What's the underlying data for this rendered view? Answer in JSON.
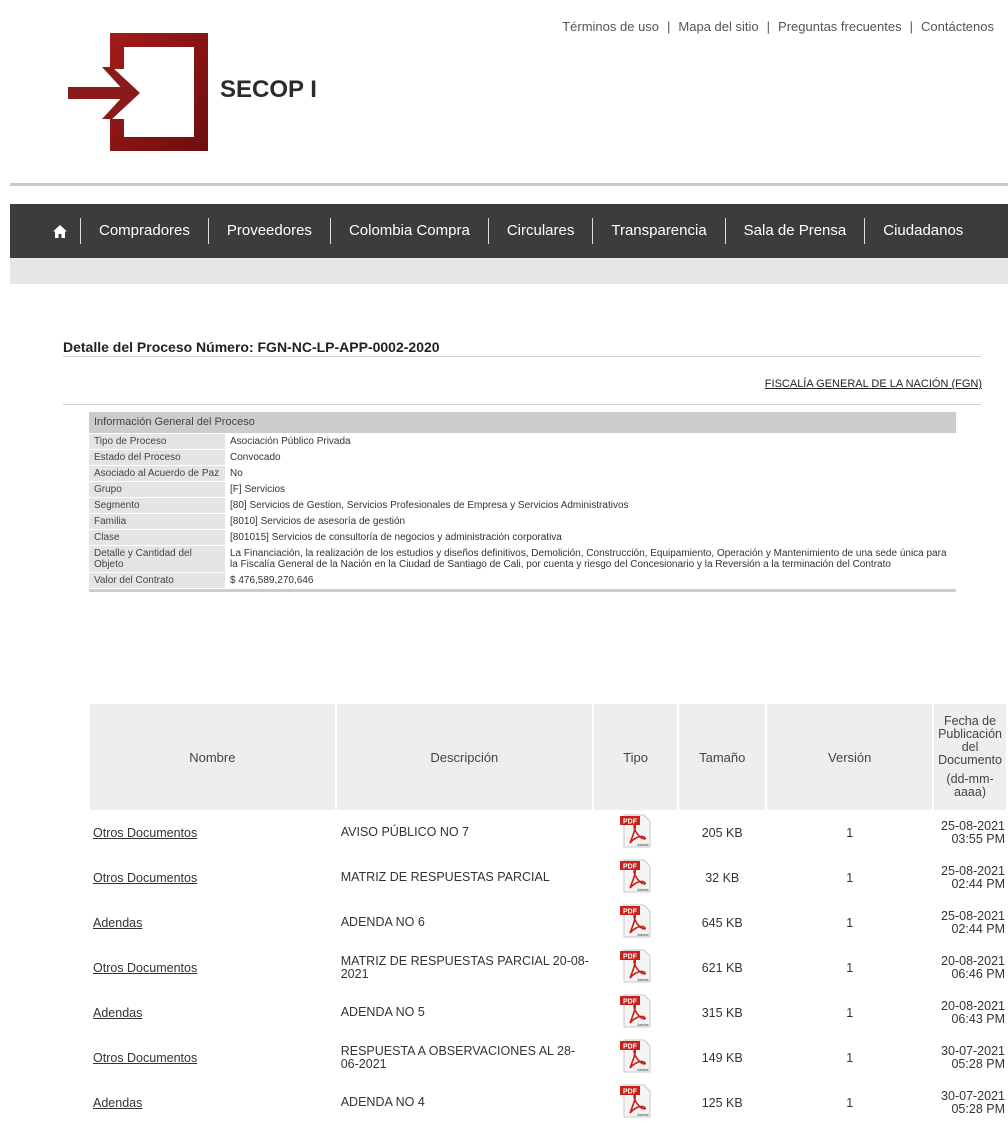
{
  "header": {
    "links": [
      "Términos de uso",
      "Mapa del sitio",
      "Preguntas frecuentes",
      "Contáctenos"
    ],
    "brand": "SECOP I",
    "logo_color": "#8b1a1a"
  },
  "nav": {
    "items": [
      "Compradores",
      "Proveedores",
      "Colombia Compra",
      "Circulares",
      "Transparencia",
      "Sala de Prensa",
      "Ciudadanos"
    ]
  },
  "process": {
    "title": "Detalle del Proceso Número: FGN-NC-LP-APP-0002-2020",
    "entity": "FISCALÍA GENERAL DE LA NACIÓN (FGN)"
  },
  "info": {
    "header": "Información General del Proceso",
    "rows": [
      {
        "label": "Tipo de Proceso",
        "value": "Asociación Público Privada"
      },
      {
        "label": "Estado del Proceso",
        "value": "Convocado"
      },
      {
        "label": "Asociado al Acuerdo de Paz",
        "value": "No"
      },
      {
        "label": "Grupo",
        "value": "[F] Servicios"
      },
      {
        "label": "Segmento",
        "value": "[80] Servicios de Gestion, Servicios Profesionales de Empresa y Servicios Administrativos"
      },
      {
        "label": "Familia",
        "value": "[8010] Servicios de asesoría de gestión"
      },
      {
        "label": "Clase",
        "value": "[801015] Servicios de consultoría de negocios y administración corporativa"
      },
      {
        "label": "Detalle y Cantidad del Objeto",
        "value": "La Financiación, la realización de los estudios y diseños definitivos, Demolición, Construcción, Equipamiento, Operación y Mantenimiento de una sede única para la Fiscalía General de la Nación en la Ciudad de Santiago de Cali, por cuenta y riesgo del Concesionario y la Reversión a la terminación del Contrato"
      },
      {
        "label": "Valor del Contrato",
        "value": "$ 476,589,270,646"
      }
    ]
  },
  "docs": {
    "headers": {
      "nombre": "Nombre",
      "descripcion": "Descripción",
      "tipo": "Tipo",
      "tamano": "Tamaño",
      "version": "Versión",
      "fecha": "Fecha de Publicación del Documento",
      "fecha_fmt": "(dd-mm-aaaa)"
    },
    "rows": [
      {
        "nombre": "Otros Documentos",
        "descripcion": "AVISO PÚBLICO NO 7",
        "tipo": "pdf-icon",
        "tamano": "205 KB",
        "version": "1",
        "fecha": "25-08-2021",
        "hora": "03:55 PM"
      },
      {
        "nombre": "Otros Documentos",
        "descripcion": "MATRIZ DE RESPUESTAS PARCIAL",
        "tipo": "pdf-icon",
        "tamano": "32 KB",
        "version": "1",
        "fecha": "25-08-2021",
        "hora": "02:44 PM"
      },
      {
        "nombre": "Adendas",
        "descripcion": "ADENDA NO 6",
        "tipo": "pdf-icon",
        "tamano": "645 KB",
        "version": "1",
        "fecha": "25-08-2021",
        "hora": "02:44 PM"
      },
      {
        "nombre": "Otros Documentos",
        "descripcion": "MATRIZ DE RESPUESTAS PARCIAL 20-08-2021",
        "tipo": "pdf-icon",
        "tamano": "621 KB",
        "version": "1",
        "fecha": "20-08-2021",
        "hora": "06:46 PM"
      },
      {
        "nombre": "Adendas",
        "descripcion": "ADENDA NO 5",
        "tipo": "pdf-icon",
        "tamano": "315 KB",
        "version": "1",
        "fecha": "20-08-2021",
        "hora": "06:43 PM"
      },
      {
        "nombre": "Otros Documentos",
        "descripcion": "RESPUESTA A OBSERVACIONES AL 28-06-2021",
        "tipo": "pdf-icon",
        "tamano": "149 KB",
        "version": "1",
        "fecha": "30-07-2021",
        "hora": "05:28 PM"
      },
      {
        "nombre": "Adendas",
        "descripcion": "ADENDA NO 4",
        "tipo": "pdf-icon",
        "tamano": "125 KB",
        "version": "1",
        "fecha": "30-07-2021",
        "hora": "05:28 PM"
      }
    ]
  }
}
